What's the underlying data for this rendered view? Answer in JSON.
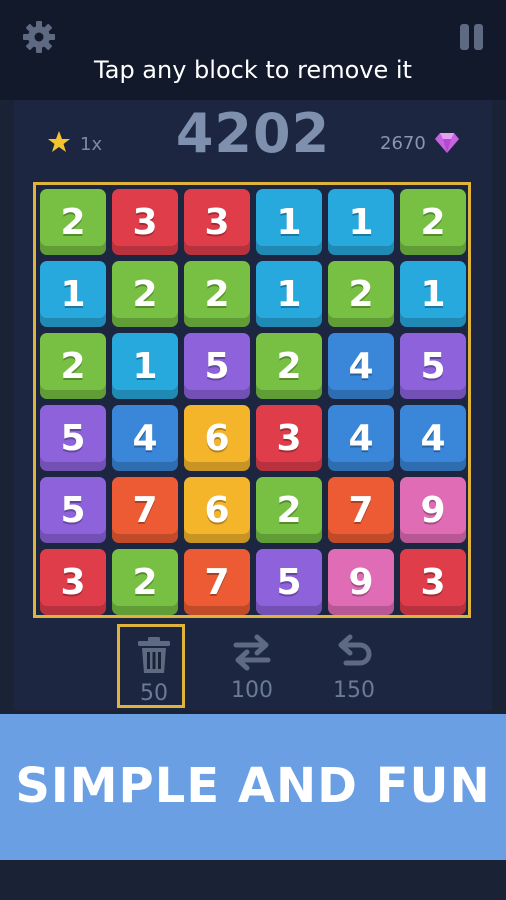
{
  "header": {
    "hint": "Tap any block to remove it"
  },
  "stats": {
    "multiplier": "1x",
    "score": "4202",
    "gems": "2670"
  },
  "board": {
    "rows": [
      [
        "2",
        "3",
        "3",
        "1",
        "1",
        "2"
      ],
      [
        "1",
        "2",
        "2",
        "1",
        "2",
        "1"
      ],
      [
        "2",
        "1",
        "5",
        "2",
        "4",
        "5"
      ],
      [
        "5",
        "4",
        "6",
        "3",
        "4",
        "4"
      ],
      [
        "5",
        "7",
        "6",
        "2",
        "7",
        "9"
      ],
      [
        "3",
        "2",
        "7",
        "5",
        "9",
        "3"
      ]
    ],
    "colors": {
      "1": "#28a9dd",
      "2": "#77c043",
      "3": "#e03d4b",
      "4": "#3a86d8",
      "5": "#8d62db",
      "6": "#f4b52b",
      "7": "#ec5b33",
      "9": "#e06cb5"
    }
  },
  "tools": [
    {
      "icon": "trash-icon",
      "cost": "50",
      "selected": true
    },
    {
      "icon": "swap-icon",
      "cost": "100",
      "selected": false
    },
    {
      "icon": "undo-icon",
      "cost": "150",
      "selected": false
    }
  ],
  "banner": {
    "text": "SIMPLE AND FUN"
  },
  "colors": {
    "accent": "#e0b43a",
    "banner": "#6b9fe3",
    "background": "#1a2236"
  }
}
